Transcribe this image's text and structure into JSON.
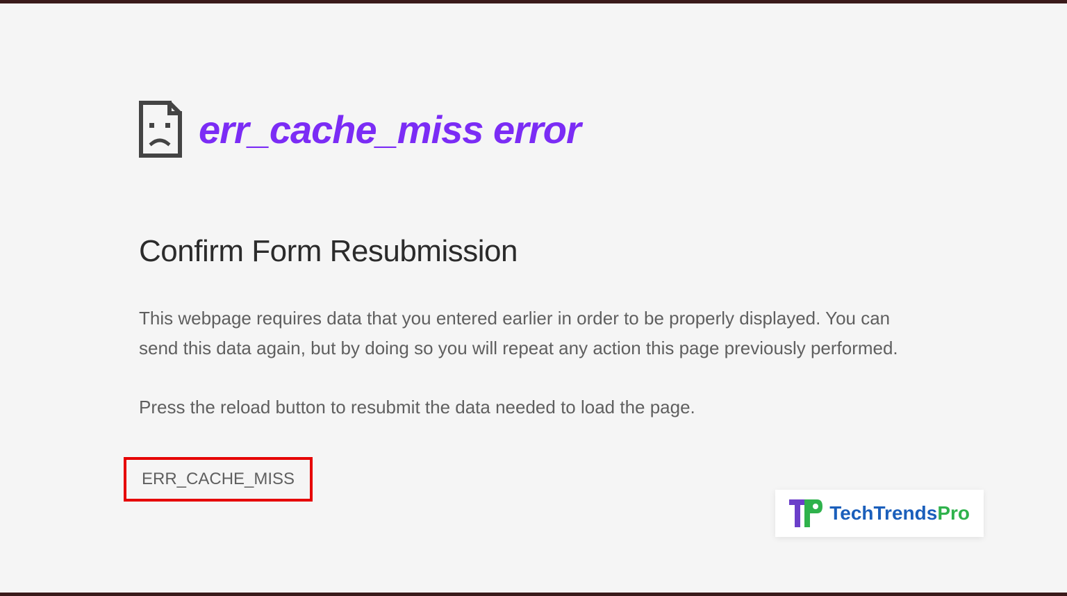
{
  "overlay_title": "err_cache_miss error",
  "heading": "Confirm Form Resubmission",
  "body_p1": "This webpage requires data that you entered earlier in order to be properly displayed. You can send this data again, but by doing so you will repeat any action this page previously performed.",
  "body_p2": "Press the reload button to resubmit the data needed to load the page.",
  "error_code": "ERR_CACHE_MISS",
  "logo": {
    "brand_main": "TechTrends",
    "brand_suffix": "Pro"
  },
  "colors": {
    "overlay_purple": "#7b2cf5",
    "highlight_red": "#e60000",
    "logo_blue": "#1b5fbb",
    "logo_green": "#2fb24c"
  }
}
